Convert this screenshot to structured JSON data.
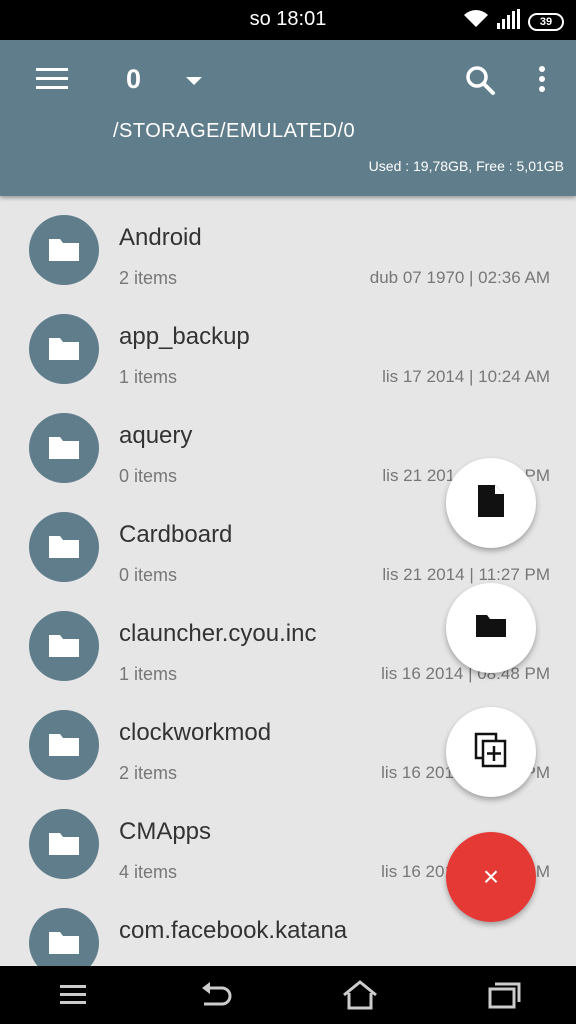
{
  "status_bar": {
    "time": "so 18:01",
    "battery": "39"
  },
  "toolbar": {
    "title": "0",
    "path": "/STORAGE/EMULATED/0",
    "usage": "Used : 19,78GB, Free : 5,01GB"
  },
  "files": [
    {
      "name": "Android",
      "count": "2 items",
      "date": "dub 07 1970 | 02:36 AM"
    },
    {
      "name": "app_backup",
      "count": "1 items",
      "date": "lis 17 2014 | 10:24 AM"
    },
    {
      "name": "aquery",
      "count": "0 items",
      "date": "lis 21 2014 | 11:27 PM"
    },
    {
      "name": "Cardboard",
      "count": "0 items",
      "date": "lis 21 2014 | 11:27 PM"
    },
    {
      "name": "clauncher.cyou.inc",
      "count": "1 items",
      "date": "lis 16 2014 | 08:48 PM"
    },
    {
      "name": "clockworkmod",
      "count": "2 items",
      "date": "lis 16 2014 | 08:48 PM"
    },
    {
      "name": "CMApps",
      "count": "4 items",
      "date": "lis 16 2014 | 08:48 PM"
    },
    {
      "name": "com.facebook.katana",
      "count": "",
      "date": ""
    }
  ],
  "fab": {
    "main_glyph": "×"
  },
  "colors": {
    "primary": "#607d8b",
    "accent": "#e53935",
    "list_bg": "#e6e6e6"
  }
}
